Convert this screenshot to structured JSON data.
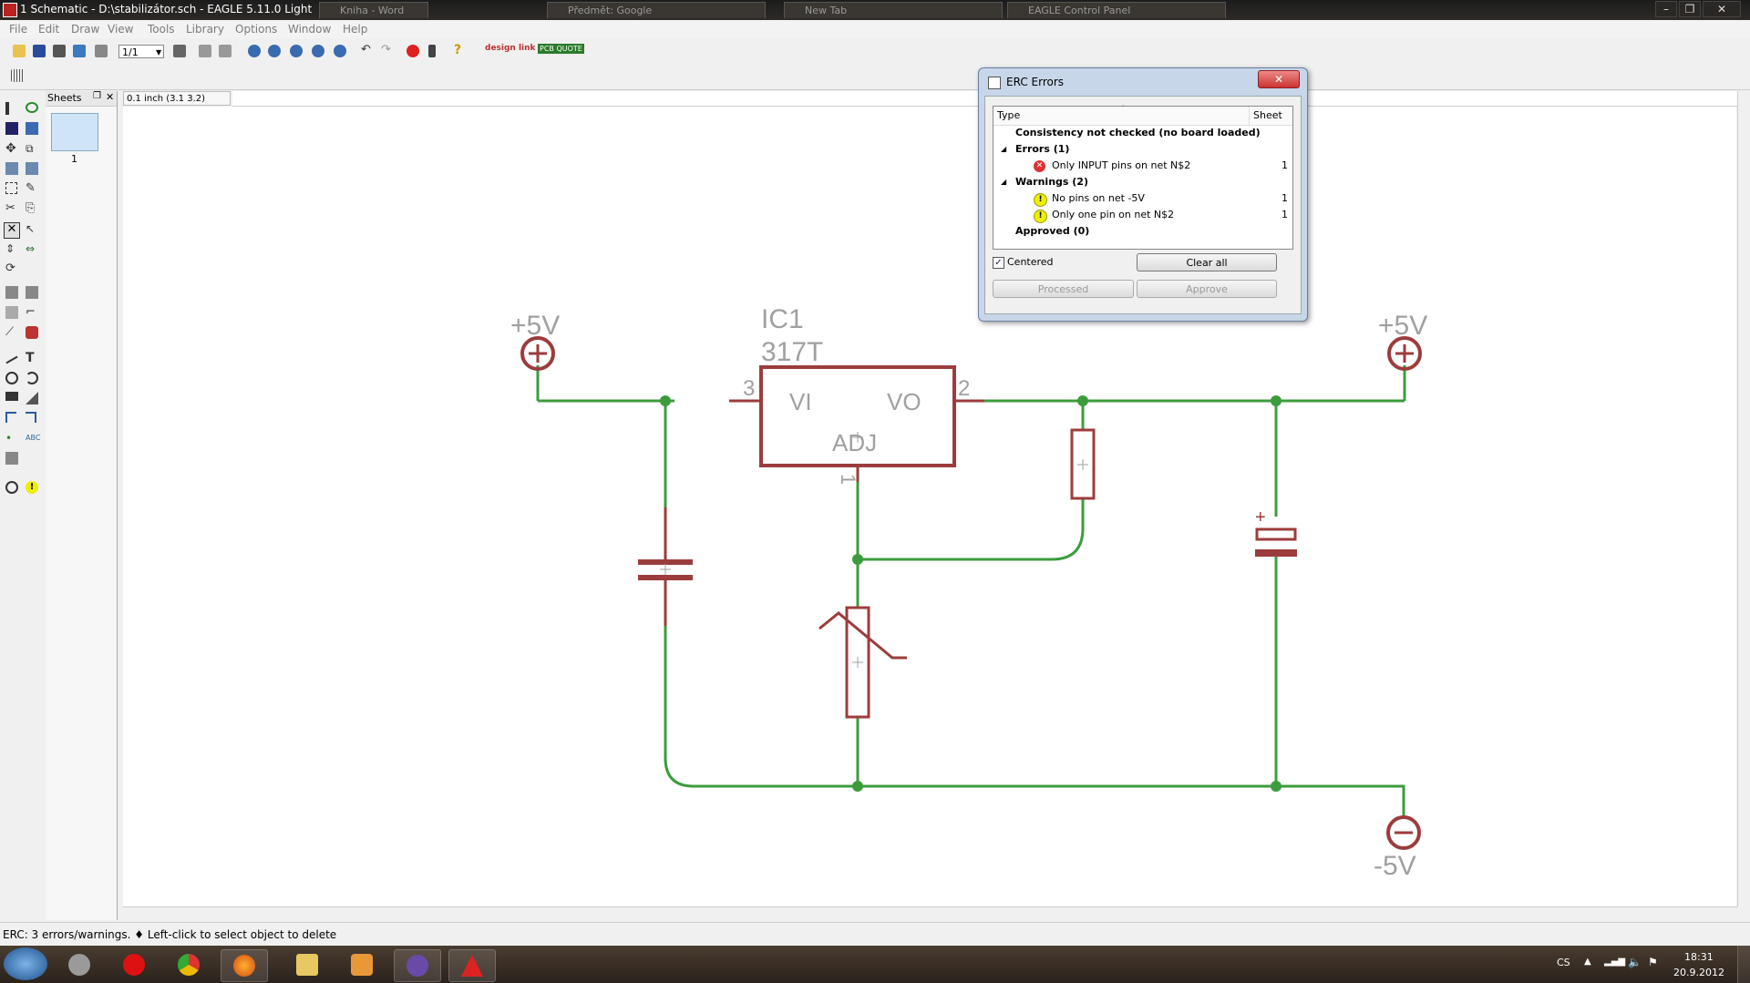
{
  "window": {
    "title": "1 Schematic - D:\\stabilizátor.sch - EAGLE 5.11.0 Light",
    "background_tabs": [
      "Kniha - Word",
      "Předmět: Google",
      "New Tab",
      "EAGLE Control Panel"
    ],
    "controls": [
      "–",
      "❐",
      "✕"
    ]
  },
  "menu": [
    "File",
    "Edit",
    "Draw",
    "View",
    "Tools",
    "Library",
    "Options",
    "Window",
    "Help"
  ],
  "toolbar": {
    "zoom_value": "1/1",
    "design_link_label": "design link",
    "pcb_quote_label": "PCB QUOTE"
  },
  "sheets_panel": {
    "title": "Sheets",
    "sheet_number": "1"
  },
  "coordinate_display": "0.1 inch (3.1 3.2)",
  "schematic": {
    "left_supply_label": "+5V",
    "right_supply_label": "+5V",
    "negative_supply_label": "-5V",
    "ic_name": "IC1",
    "ic_value": "317T",
    "pin_vi": "VI",
    "pin_vo": "VO",
    "pin_adj": "ADJ",
    "pin3": "3",
    "pin2": "2",
    "pin1": "1",
    "capacitor_polarity": "+"
  },
  "erc_dialog": {
    "title": "ERC Errors",
    "close_label": "✕",
    "col_type": "Type",
    "col_sheet": "Sheet",
    "rows": [
      {
        "text": "Consistency not checked (no board loaded)",
        "sheet": "",
        "kind": "header"
      },
      {
        "text": "Errors (1)",
        "sheet": "",
        "kind": "group"
      },
      {
        "text": "Only INPUT pins on net N$2",
        "sheet": "1",
        "kind": "error"
      },
      {
        "text": "Warnings (2)",
        "sheet": "",
        "kind": "group"
      },
      {
        "text": "No pins on net -5V",
        "sheet": "1",
        "kind": "warning"
      },
      {
        "text": "Only one pin on net N$2",
        "sheet": "1",
        "kind": "warning"
      },
      {
        "text": "Approved (0)",
        "sheet": "",
        "kind": "header"
      }
    ],
    "centered_label": "Centered",
    "centered_checked": true,
    "clear_all_label": "Clear all",
    "processed_label": "Processed",
    "approve_label": "Approve"
  },
  "status": "ERC: 3 errors/warnings.  ♦ Left-click to select object to delete",
  "taskbar": {
    "language": "CS",
    "time": "18:31",
    "date": "20.9.2012"
  },
  "colors": {
    "wire": "#3c9c3c",
    "symbol": "#9c3c3c",
    "label": "#a0a0a0"
  }
}
